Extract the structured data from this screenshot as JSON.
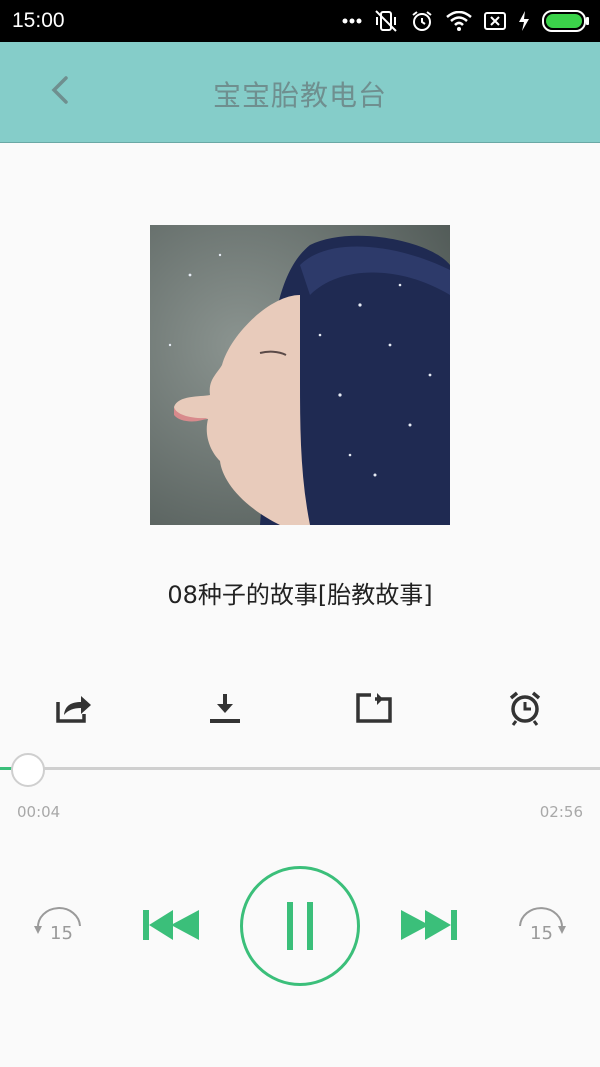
{
  "status_bar": {
    "time": "15:00",
    "icons": [
      "dots-icon",
      "vibrate-off-icon",
      "alarm-icon",
      "wifi-icon",
      "sim-off-icon",
      "charging-icon",
      "battery-icon"
    ],
    "battery_color": "#3bd34a"
  },
  "header": {
    "title": "宝宝胎教电台",
    "back_icon": "chevron-left-icon",
    "background": "#85cdc9"
  },
  "track": {
    "title": "08种子的故事[胎教故事]"
  },
  "actions": [
    {
      "name": "share-icon"
    },
    {
      "name": "download-icon"
    },
    {
      "name": "repeat-icon"
    },
    {
      "name": "timer-alarm-icon"
    }
  ],
  "progress": {
    "elapsed": "00:04",
    "total": "02:56",
    "fraction": 0.023
  },
  "controls": {
    "rewind_label": "15",
    "forward_label": "15",
    "accent": "#3bbf7a"
  }
}
